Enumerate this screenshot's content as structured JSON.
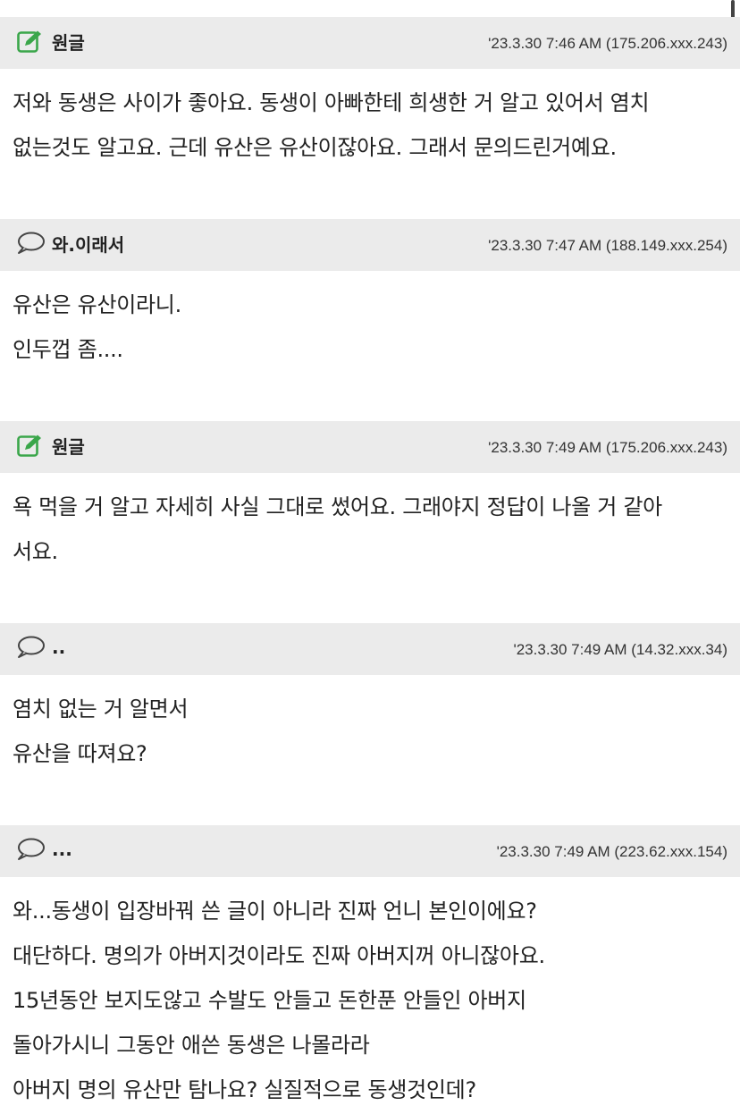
{
  "comments": [
    {
      "author": "원글",
      "author_icon": "edit-icon",
      "meta": "'23.3.30 7:46 AM (175.206.xxx.243)",
      "lines": [
        "저와 동생은 사이가 좋아요. 동생이 아빠한테 희생한 거 알고 있어서 염치",
        "없는것도 알고요. 근데 유산은 유산이잖아요. 그래서 문의드린거예요."
      ]
    },
    {
      "author": "와.이래서",
      "author_icon": "speech-bubble-icon",
      "meta": "'23.3.30 7:47 AM (188.149.xxx.254)",
      "lines": [
        "유산은 유산이라니.",
        "인두껍 좀...."
      ]
    },
    {
      "author": "원글",
      "author_icon": "edit-icon",
      "meta": "'23.3.30 7:49 AM (175.206.xxx.243)",
      "lines": [
        "욕 먹을 거 알고 자세히 사실 그대로 썼어요. 그래야지 정답이 나올 거 같아",
        "서요."
      ]
    },
    {
      "author": "..",
      "author_icon": "speech-bubble-icon",
      "meta": "'23.3.30 7:49 AM (14.32.xxx.34)",
      "lines": [
        "염치 없는 거 알면서",
        "유산을 따져요?"
      ]
    },
    {
      "author": "...",
      "author_icon": "speech-bubble-icon",
      "meta": "'23.3.30 7:49 AM (223.62.xxx.154)",
      "lines": [
        "와...동생이 입장바꿔 쓴 글이 아니라 진짜 언니 본인이에요?",
        "대단하다. 명의가 아버지것이라도 진짜 아버지꺼 아니잖아요.",
        "15년동안 보지도않고 수발도 안들고 돈한푼 안들인 아버지",
        "돌아가시니 그동안 애쓴 동생은 나몰라라",
        "아버지 명의 유산만 탐나요? 실질적으로 동생것인데?"
      ]
    }
  ],
  "colors": {
    "header_bg": "#ebebeb",
    "edit_icon_green": "#3aa64a",
    "text": "#222222"
  }
}
